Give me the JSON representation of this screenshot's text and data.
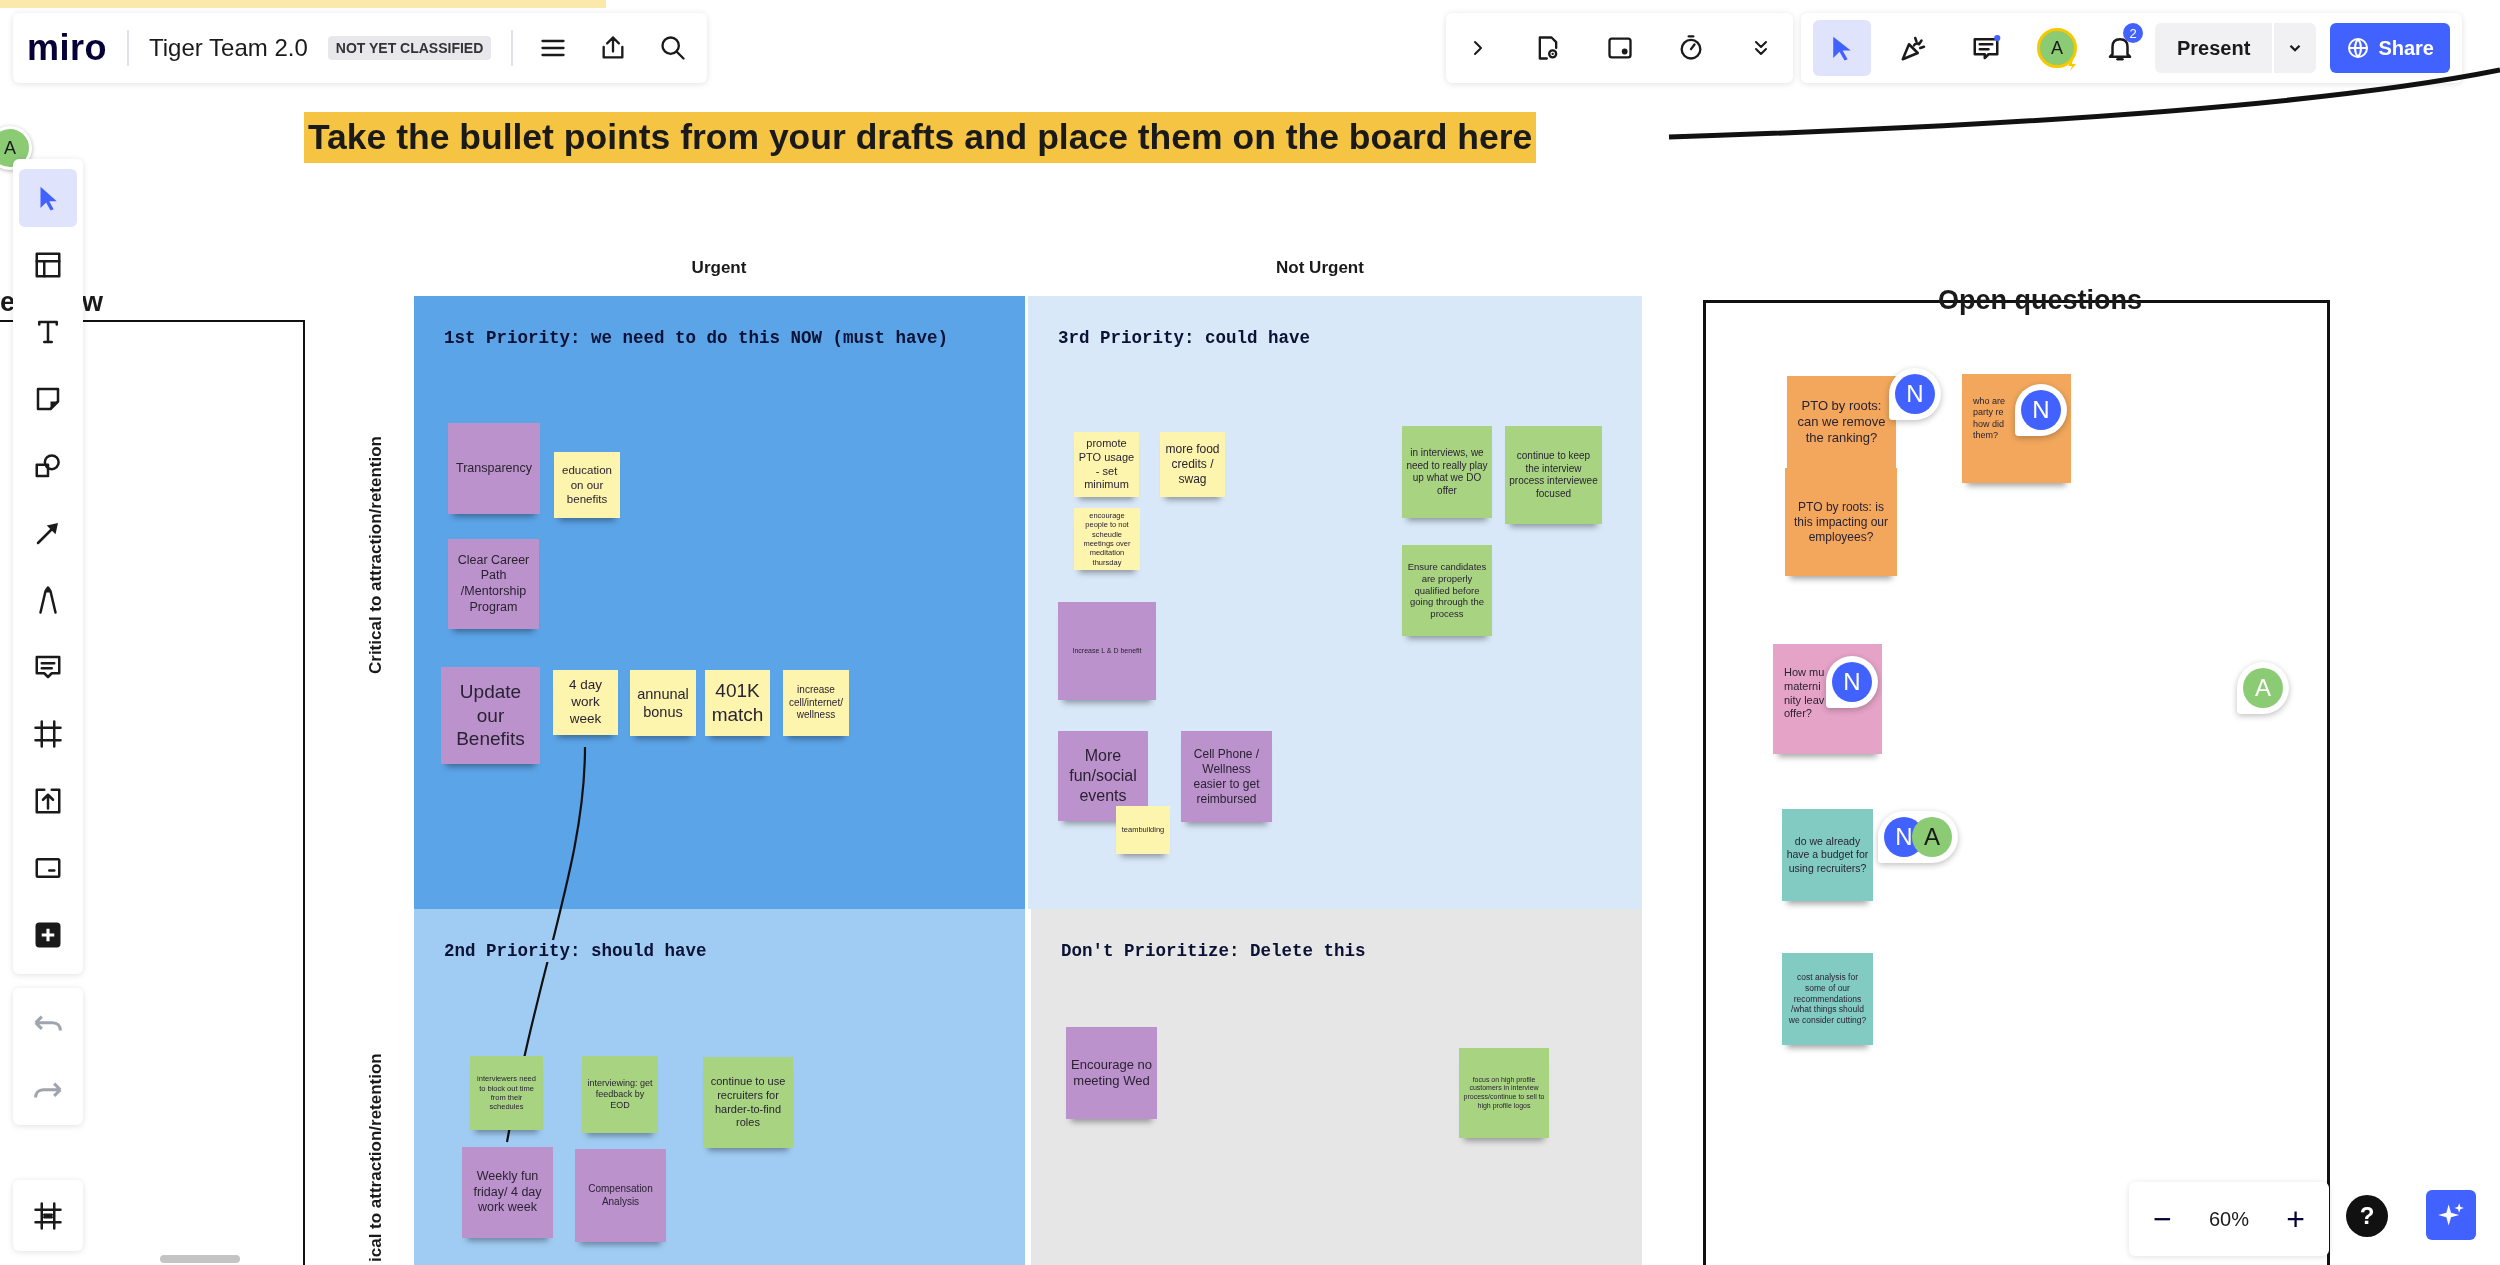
{
  "topbar": {
    "logo": "miro",
    "board_title": "Tiger Team 2.0",
    "classification": "NOT YET CLASSIFIED"
  },
  "board_tools": {
    "tools": [
      {
        "kind": "select",
        "selected": true
      },
      {
        "kind": "reactions",
        "selected": false
      },
      {
        "kind": "comments",
        "selected": false
      }
    ],
    "avatar": "A",
    "notifications": "2",
    "present": "Present",
    "share": "Share"
  },
  "left_toolbar": {
    "tools": [
      {
        "kind": "select",
        "selected": true
      },
      {
        "kind": "templates",
        "selected": false
      },
      {
        "kind": "text",
        "selected": false
      },
      {
        "kind": "sticky",
        "selected": false
      },
      {
        "kind": "shapes",
        "selected": false
      },
      {
        "kind": "arrow",
        "selected": false
      },
      {
        "kind": "pen",
        "selected": false
      },
      {
        "kind": "comment",
        "selected": false
      },
      {
        "kind": "frame",
        "selected": false
      },
      {
        "kind": "upload",
        "selected": false
      },
      {
        "kind": "card",
        "selected": false
      },
      {
        "kind": "more",
        "selected": false
      }
    ],
    "history": [
      {
        "kind": "undo",
        "disabled": true
      },
      {
        "kind": "redo",
        "disabled": true
      }
    ]
  },
  "canvas": {
    "instruction": "Take the bullet points from your drafts and place them on the board here",
    "left_frame_title_parts": [
      "e",
      "w"
    ],
    "column_labels": [
      "Urgent",
      "Not Urgent"
    ],
    "row_labels": [
      "Critical to attraction/retention",
      "ical to attraction/retention"
    ],
    "quadrants": [
      {
        "title": "1st Priority: we need to do this NOW (must have)",
        "color": "#5ca4e8",
        "stickies": [
          {
            "text": "Transparency",
            "color": "#bb92cb"
          },
          {
            "text": "education on our benefits",
            "color": "#fdf5ad"
          },
          {
            "text": "Clear Career Path /Mentorship Program",
            "color": "#bb92cb"
          },
          {
            "text": "Update our Benefits",
            "color": "#bb92cb"
          },
          {
            "text": "4 day work week",
            "color": "#fdf5ad"
          },
          {
            "text": "annunal bonus",
            "color": "#fdf5ad"
          },
          {
            "text": "401K match",
            "color": "#fdf5ad"
          },
          {
            "text": "increase cell/internet/wellness",
            "color": "#fdf5ad"
          }
        ]
      },
      {
        "title": "3rd Priority: could have",
        "color": "#d9e8f8",
        "stickies": [
          {
            "text": "promote PTO usage - set minimum",
            "color": "#fdf5ad"
          },
          {
            "text": "more food credits / swag",
            "color": "#fdf5ad"
          },
          {
            "text": "encourage people to not scheudle meetings over meditation thursday",
            "color": "#fdf5ad"
          },
          {
            "text": "in interviews, we need to really play up what we DO offer",
            "color": "#a8d482"
          },
          {
            "text": "continue to keep the interview process interviewee focused",
            "color": "#a8d482"
          },
          {
            "text": "Ensure candidates are properly qualified before going through the process",
            "color": "#a8d482"
          },
          {
            "text": "Increase L & D benefit",
            "color": "#bb92cb"
          },
          {
            "text": "More fun/social events",
            "color": "#bb92cb"
          },
          {
            "text": "teambuilding",
            "color": "#fdf5ad"
          },
          {
            "text": "Cell Phone / Wellness easier to get reimbursed",
            "color": "#bb92cb"
          }
        ]
      },
      {
        "title": "2nd Priority: should have",
        "color": "#a0ccf3",
        "stickies": [
          {
            "text": "interviewers need to block out time from their schedules",
            "color": "#a8d482"
          },
          {
            "text": "interviewing: get feedback by EOD",
            "color": "#a8d482"
          },
          {
            "text": "continue to use recruiters for harder-to-find roles",
            "color": "#a8d482"
          },
          {
            "text": "Weekly fun friday/ 4 day work week",
            "color": "#bb92cb"
          },
          {
            "text": "Compensation Analysis",
            "color": "#bb92cb"
          }
        ]
      },
      {
        "title": "Don't Prioritize: Delete this",
        "color": "#e6e6e6",
        "stickies": [
          {
            "text": "Encourage no meeting Wed",
            "color": "#bb92cb"
          },
          {
            "text": "focus on high profile customers in interview process/continue to sell to high profile logos",
            "color": "#a8d482"
          }
        ]
      }
    ],
    "open_questions": {
      "title": "Open questions",
      "stickies": [
        {
          "text": "PTO by roots: can we remove the ranking?",
          "color": "#f2a75c"
        },
        {
          "lines": [
            "who are",
            "party re",
            "how did",
            "them?"
          ],
          "color": "#f2a75c"
        },
        {
          "text": "PTO by roots: is this impacting our employees?",
          "color": "#f2a75c"
        },
        {
          "lines": [
            "How mu",
            "materni",
            "nity leav",
            "offer?"
          ],
          "color": "#e5a3c7"
        },
        {
          "text": "do we already have a budget for using recruiters?",
          "color": "#82cbc3"
        },
        {
          "text": "cost analysis for some of our recommendations /what things should we consider cutting?",
          "color": "#82cbc3"
        }
      ]
    },
    "comment_pins": [
      {
        "avatars": [
          {
            "initial": "N",
            "color": "#4262ff"
          }
        ]
      },
      {
        "avatars": [
          {
            "initial": "N",
            "color": "#4262ff"
          }
        ]
      },
      {
        "avatars": [
          {
            "initial": "N",
            "color": "#4262ff"
          }
        ]
      },
      {
        "avatars": [
          {
            "initial": "A",
            "color": "#8acb74"
          }
        ]
      },
      {
        "avatars": [
          {
            "initial": "N",
            "color": "#4262ff"
          },
          {
            "initial": "A",
            "color": "#8acb74"
          }
        ]
      }
    ],
    "presence_avatar": {
      "initial": "A",
      "color": "#8acb74"
    }
  },
  "zoom_controls": {
    "zoom_out": "−",
    "level": "60%",
    "zoom_in": "+",
    "help": "?"
  }
}
